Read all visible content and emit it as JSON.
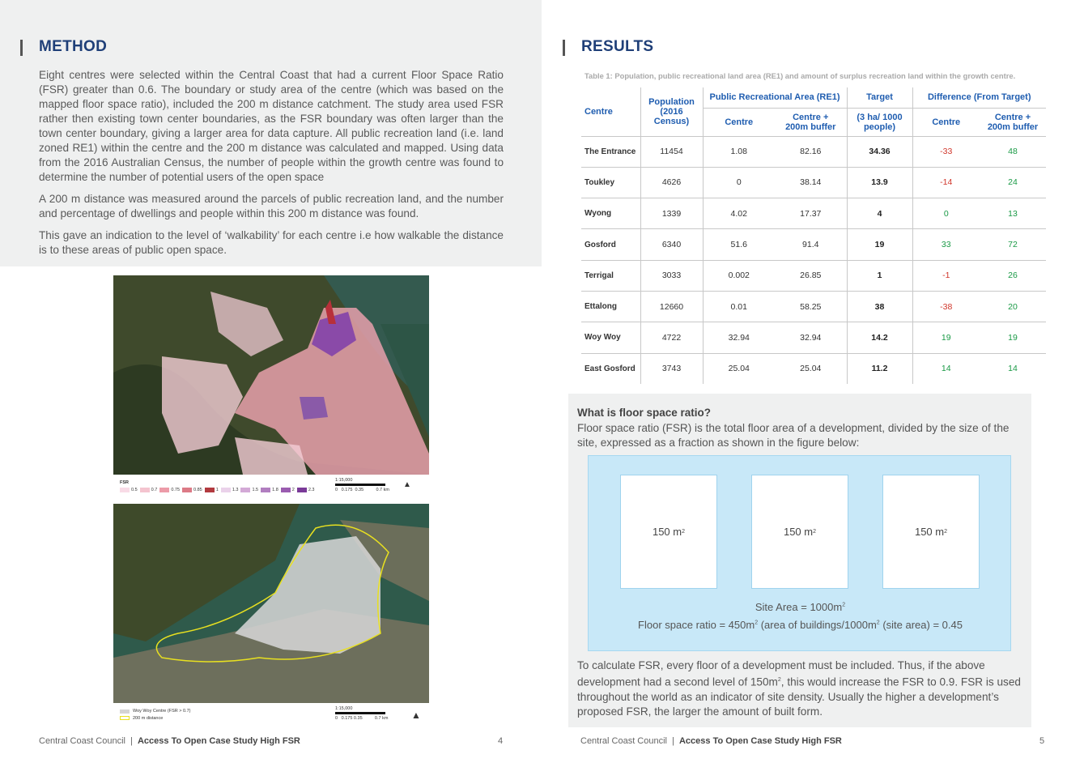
{
  "left_page": {
    "heading": "METHOD",
    "paragraphs": [
      "Eight centres were selected within the Central Coast that had a current Floor Space Ratio (FSR) greater than 0.6. The boundary or study area of the centre (which was based on the mapped floor space ratio), included the 200 m distance catchment. The study area used FSR rather then existing town center boundaries, as the FSR boundary was often larger than the town center boundary, giving a larger area for data capture. All public recreation land (i.e. land zoned RE1) within the centre and the 200 m distance was calculated and mapped. Using data from the 2016 Australian Census, the number of people within the growth centre was found to determine the number of potential users of the open space",
      "A 200 m distance was measured around the parcels of public recreation land, and the number and percentage of dwellings and people within this 200 m distance was found.",
      "This gave an indication to the level of ‘walkability’ for each centre i.e how walkable the distance is to these areas of public open space."
    ],
    "map1_legend": {
      "title": "FSR",
      "items": [
        "0.5",
        "0.7",
        "0.75",
        "0.85",
        "1",
        "1.3",
        "1.5",
        "1.8",
        "2",
        "2.3"
      ],
      "colors": [
        "#f8dbe6",
        "#f4c4cf",
        "#ec9ba8",
        "#dc7a86",
        "#b23a3f",
        "#ead2ea",
        "#d3a9d6",
        "#b17ec0",
        "#9a5cb0",
        "#7a3a98"
      ],
      "scale": "1:15,000",
      "scale_ticks": "0   0.175  0.35          0.7 km",
      "north": "N"
    },
    "map2_legend": {
      "item1": "Woy Woy Centre (FSR > 0.7)",
      "item2": "200 m distance",
      "scale": "1:15,000",
      "scale_ticks": "0   0.175 0.35          0.7 km",
      "north": "N"
    },
    "footer_org": "Central Coast Council",
    "footer_sep": "|",
    "footer_title": "Access To Open Case Study High FSR",
    "page_number": "4"
  },
  "right_page": {
    "heading": "RESULTS",
    "table_caption": "Table 1: Population, public recreational land area (RE1) and amount of surplus recreation land within the growth centre.",
    "table_headers": {
      "centre": "Centre",
      "population": "Population (2016 Census)",
      "pra": "Public Recreational Area (RE1)",
      "pra_centre": "Centre",
      "pra_buffer": "Centre + 200m buffer",
      "target": "Target",
      "target_sub": "(3 ha/ 1000 people)",
      "difference": "Difference (From Target)",
      "diff_centre": "Centre",
      "diff_buffer": "Centre + 200m buffer"
    },
    "table_rows": [
      {
        "centre": "The Entrance",
        "population": "11454",
        "pra_centre": "1.08",
        "pra_buffer": "82.16",
        "target": "34.36",
        "diff_centre": "-33",
        "diff_buffer": "48"
      },
      {
        "centre": "Toukley",
        "population": "4626",
        "pra_centre": "0",
        "pra_buffer": "38.14",
        "target": "13.9",
        "diff_centre": "-14",
        "diff_buffer": "24"
      },
      {
        "centre": "Wyong",
        "population": "1339",
        "pra_centre": "4.02",
        "pra_buffer": "17.37",
        "target": "4",
        "diff_centre": "0",
        "diff_buffer": "13"
      },
      {
        "centre": "Gosford",
        "population": "6340",
        "pra_centre": "51.6",
        "pra_buffer": "91.4",
        "target": "19",
        "diff_centre": "33",
        "diff_buffer": "72"
      },
      {
        "centre": "Terrigal",
        "population": "3033",
        "pra_centre": "0.002",
        "pra_buffer": "26.85",
        "target": "1",
        "diff_centre": "-1",
        "diff_buffer": "26"
      },
      {
        "centre": "Ettalong",
        "population": "12660",
        "pra_centre": "0.01",
        "pra_buffer": "58.25",
        "target": "38",
        "diff_centre": "-38",
        "diff_buffer": "20"
      },
      {
        "centre": "Woy Woy",
        "population": "4722",
        "pra_centre": "32.94",
        "pra_buffer": "32.94",
        "target": "14.2",
        "diff_centre": "19",
        "diff_buffer": "19"
      },
      {
        "centre": "East Gosford",
        "population": "3743",
        "pra_centre": "25.04",
        "pra_buffer": "25.04",
        "target": "11.2",
        "diff_centre": "14",
        "diff_buffer": "14"
      }
    ],
    "colors": {
      "negative": "#d0352a",
      "positive": "#1a9a46",
      "heading": "#1f3f78",
      "table_header": "#1f5db0"
    },
    "fsr_box": {
      "title": "What is floor space ratio?",
      "intro": "Floor space ratio (FSR) is the total floor area of a development, divided by the size of the site, expressed as a fraction as shown in the figure below:",
      "building_label": "150 m",
      "building_sup": "2",
      "site_area_prefix": "Site Area = 1000m",
      "site_area_sup": "2",
      "ratio_a": "Floor space ratio = 450m",
      "ratio_b": " (area of buildings/1000m",
      "ratio_c": " (site area) = 0.45",
      "sup2": "2",
      "outro_a": "To calculate FSR, every floor of a development must be included. Thus, if the above development had a second level of 150m",
      "outro_b": ", this would increase the FSR to 0.9. FSR is used throughout the world as an indicator of site density. Usually the higher a development’s proposed FSR, the larger the amount of built form."
    },
    "footer_org": "Central Coast Council",
    "footer_sep": "|",
    "footer_title": "Access To Open Case Study High FSR",
    "page_number": "5"
  }
}
